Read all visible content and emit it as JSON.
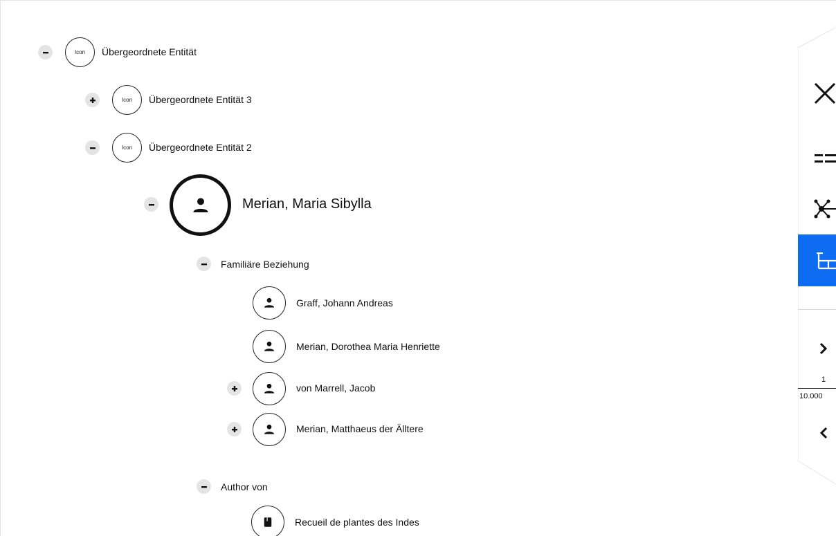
{
  "tree": {
    "root": {
      "icon_text": "Icon",
      "label": "Übergeordnete Entität"
    },
    "parent3": {
      "icon_text": "Icon",
      "label": "Übergeordnete Entität 3"
    },
    "parent2": {
      "icon_text": "Icon",
      "label": "Übergeordnete Entität 2"
    },
    "focus": {
      "label": "Merian, Maria Sibylla"
    },
    "family": {
      "label": "Familiäre Beziehung",
      "members": [
        {
          "label": "Graff, Johann Andreas"
        },
        {
          "label": "Merian, Dorothea Maria Henriette"
        },
        {
          "label": "von Marrell, Jacob"
        },
        {
          "label": "Merian, Matthaeus der Älltere"
        }
      ]
    },
    "author": {
      "label": "Author von",
      "works": [
        {
          "label": "Recueil de plantes des Indes"
        }
      ]
    }
  },
  "side_panel": {
    "pager": {
      "current": "1",
      "total": "10.000"
    }
  },
  "colors": {
    "accent": "#0e6cf2",
    "toggle_bg": "#e4e4e4"
  }
}
